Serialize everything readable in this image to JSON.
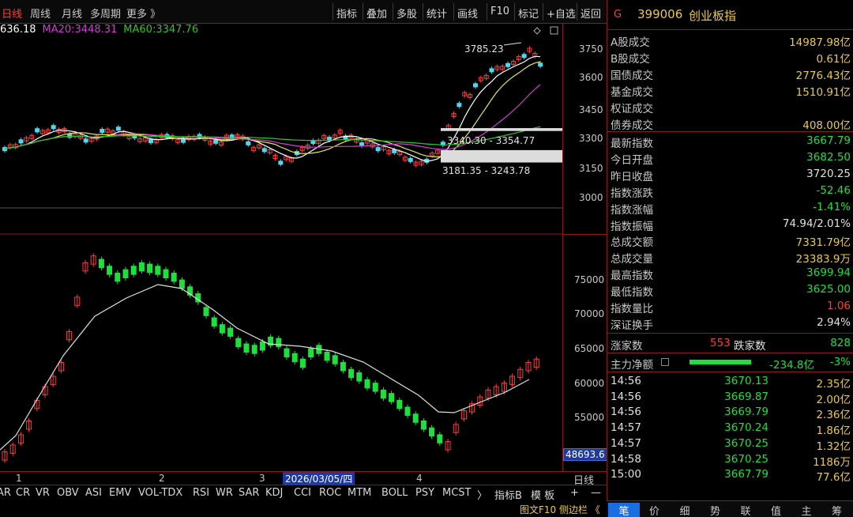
{
  "toolbar": {
    "tabs": [
      "日线",
      "周线",
      "月线",
      "多周期",
      "更多 》"
    ],
    "buttons": [
      "指标",
      "叠加",
      "多股",
      "统计",
      "画线",
      "F10",
      "标记",
      "+自选",
      "返回"
    ]
  },
  "ma": {
    "ma_first": "636.18",
    "ma20_label": "MA20:",
    "ma20": "3448.31",
    "ma60_label": "MA60:",
    "ma60": "3347.76"
  },
  "price_axis": [
    "3750",
    "3600",
    "3450",
    "3300",
    "3150",
    "3000"
  ],
  "vol_axis": [
    "75000",
    "70000",
    "65000",
    "60000",
    "55000"
  ],
  "vol_current": "48693.6",
  "annotations": {
    "high": "3785.23",
    "zone1": "3340.30 - 3354.77",
    "zone2": "3181.35 - 3243.78"
  },
  "dates": {
    "m1": "1",
    "m2": "2",
    "m3": "3",
    "cursor": "2026/03/05/四",
    "m4": "4",
    "unit": "日线"
  },
  "indicators": [
    "AR",
    "CR",
    "VR",
    "OBV",
    "ASI",
    "EMV",
    "VOL-TDX",
    "RSI",
    "WR",
    "SAR",
    "KDJ",
    "CCI",
    "ROC",
    "MTM",
    "BOLL",
    "PSY",
    "MCST"
  ],
  "ind_more": "〉",
  "ind_side": [
    "指标B",
    "模 板"
  ],
  "ind_plus": "+",
  "ind_minus": "—",
  "bottom_links": "图文F10 侧边栏 《",
  "stock": {
    "icon": "G",
    "code": "399006",
    "name": "创业板指"
  },
  "turnover": [
    {
      "label": "A股成交",
      "value": "14987.98亿"
    },
    {
      "label": "B股成交",
      "value": "0.61亿"
    },
    {
      "label": "国债成交",
      "value": "2776.43亿"
    },
    {
      "label": "基金成交",
      "value": "1510.91亿"
    },
    {
      "label": "权证成交",
      "value": ""
    },
    {
      "label": "债券成交",
      "value": "408.00亿"
    }
  ],
  "stats": [
    {
      "label": "最新指数",
      "value": "3667.79",
      "color": "dn"
    },
    {
      "label": "今日开盘",
      "value": "3682.50",
      "color": "dn"
    },
    {
      "label": "昨日收盘",
      "value": "3720.25",
      "color": "wh"
    },
    {
      "label": "指数涨跌",
      "value": "-52.46",
      "color": "dn"
    },
    {
      "label": "指数涨幅",
      "value": "-1.41%",
      "color": "dn"
    },
    {
      "label": "指数振幅",
      "value": "74.94/2.01%",
      "color": "wh"
    },
    {
      "label": "总成交额",
      "value": "7331.79亿",
      "color": "yl"
    },
    {
      "label": "总成交量",
      "value": "23383.9万",
      "color": "yl"
    },
    {
      "label": "最高指数",
      "value": "3699.94",
      "color": "dn"
    },
    {
      "label": "最低指数",
      "value": "3625.00",
      "color": "dn"
    },
    {
      "label": "指数量比",
      "value": "1.06",
      "color": "up"
    },
    {
      "label": "深证换手",
      "value": "2.94%",
      "color": "wh"
    }
  ],
  "breadth": {
    "up_label": "涨家数",
    "up": "553",
    "down_label": "跌家数",
    "down": "828"
  },
  "mainflow": {
    "label": "主力净额",
    "value": "-234.8亿",
    "pct": "-3%",
    "bar_fraction": 0.3
  },
  "ticks": [
    {
      "time": "14:56",
      "price": "3670.13",
      "vol": "2.35亿"
    },
    {
      "time": "14:56",
      "price": "3669.87",
      "vol": "2.00亿"
    },
    {
      "time": "14:56",
      "price": "3669.79",
      "vol": "2.36亿"
    },
    {
      "time": "14:57",
      "price": "3670.24",
      "vol": "1.86亿"
    },
    {
      "time": "14:57",
      "price": "3670.25",
      "vol": "1.32亿"
    },
    {
      "time": "14:58",
      "price": "3670.25",
      "vol": "1186万"
    },
    {
      "time": "15:00",
      "price": "3667.79",
      "vol": "77.6亿"
    }
  ],
  "right_tabs": [
    "笔",
    "价",
    "细",
    "势",
    "联",
    "值",
    "主",
    "筹"
  ],
  "colors": {
    "up": "#ff3b3b",
    "down": "#1de03d",
    "ma5": "#ffffff",
    "ma10": "#e8e84a",
    "ma20": "#d23cd2",
    "ma60": "#28c828",
    "grid": "#8b1a1a"
  }
}
